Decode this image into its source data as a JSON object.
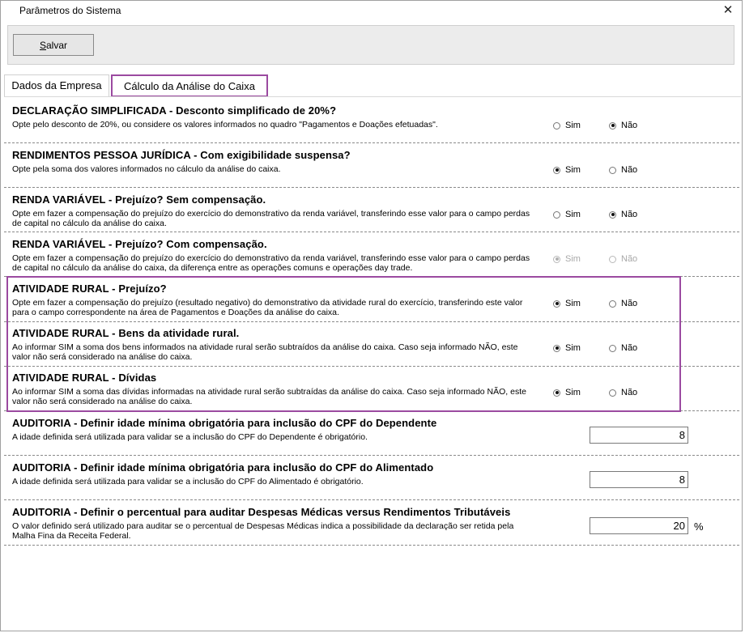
{
  "window": {
    "title": "Parâmetros do Sistema"
  },
  "toolbar": {
    "save_label_first": "S",
    "save_label_rest": "alvar"
  },
  "tabs": [
    {
      "label": "Dados da Empresa"
    },
    {
      "label": "Cálculo da Análise do Caixa"
    }
  ],
  "radio_labels": {
    "yes": "Sim",
    "no": "Não"
  },
  "options": [
    {
      "title": "DECLARAÇÃO SIMPLIFICADA - Desconto simplificado de 20%?",
      "description": "Opte pelo desconto de 20%, ou considere os valores informados no quadro \"Pagamentos e Doações efetuadas\".",
      "selected": "Não",
      "enabled": true
    },
    {
      "title": "RENDIMENTOS PESSOA JURÍDICA - Com exigibilidade suspensa?",
      "description": "Opte pela soma dos valores informados no cálculo da análise do caixa.",
      "selected": "Sim",
      "enabled": true
    },
    {
      "title": "RENDA VARIÁVEL - Prejuízo? Sem compensação.",
      "description": "Opte em fazer a compensação do prejuízo do exercício do demonstrativo da renda variável, transferindo esse valor para o campo perdas de capital no cálculo da análise do caixa.",
      "selected": "Não",
      "enabled": true
    },
    {
      "title": "RENDA VARIÁVEL - Prejuízo? Com compensação.",
      "description": "Opte em fazer a compensação do prejuízo do exercício do demonstrativo da renda variável, transferindo esse valor para o campo perdas de capital no cálculo da análise do caixa, da diferença entre as operações comuns e operações day trade.",
      "selected": "Sim",
      "enabled": false
    },
    {
      "title": "ATIVIDADE RURAL - Prejuízo?",
      "description": "Opte em fazer a compensação do prejuízo (resultado negativo) do demonstrativo da atividade rural do exercício, transferindo este valor para o campo correspondente na área de Pagamentos e Doações da análise do caixa.",
      "selected": "Sim",
      "enabled": true
    },
    {
      "title": "ATIVIDADE RURAL - Bens da atividade rural.",
      "description": "Ao informar SIM a soma dos bens informados na atividade rural serão subtraídos da análise do caixa. Caso seja informado NÃO, este valor não será considerado na análise do caixa.",
      "selected": "Sim",
      "enabled": true
    },
    {
      "title": "ATIVIDADE RURAL - Dívidas",
      "description": "Ao informar SIM a soma das dívidas informadas na atividade rural serão subtraídas da análise do caixa. Caso seja informado NÃO, este valor não será considerado na análise do caixa.",
      "selected": "Sim",
      "enabled": true
    }
  ],
  "audits": [
    {
      "title": "AUDITORIA - Definir idade mínima obrigatória para inclusão do CPF do Dependente",
      "description": "A idade definida será utilizada para validar se a inclusão do CPF do Dependente é obrigatório.",
      "value": "8",
      "suffix": ""
    },
    {
      "title": "AUDITORIA - Definir idade mínima obrigatória para inclusão do CPF do Alimentado",
      "description": "A idade definida será utilizada para validar se a inclusão do CPF do Alimentado é obrigatório.",
      "value": "8",
      "suffix": ""
    },
    {
      "title": "AUDITORIA - Definir o percentual para auditar Despesas Médicas versus Rendimentos Tributáveis",
      "description": "O valor definido será utilizado para auditar se o percentual de Despesas Médicas indica a possibilidade da declaração ser retida pela Malha Fina da Receita Federal.",
      "value": "20",
      "suffix": "%"
    }
  ]
}
